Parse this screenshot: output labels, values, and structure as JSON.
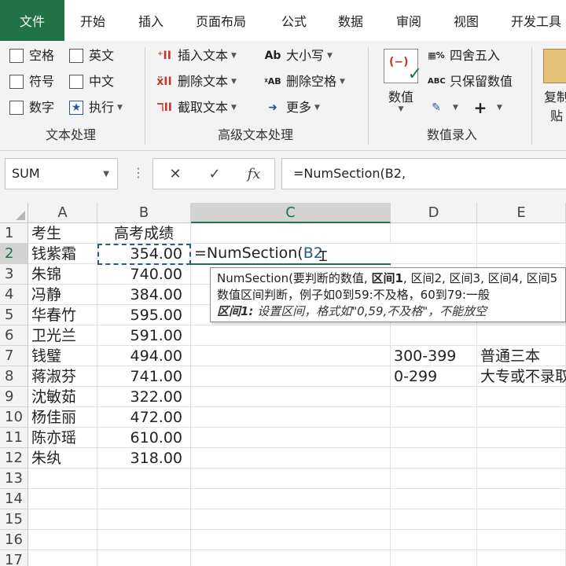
{
  "ribbon_tabs": [
    "文件",
    "开始",
    "插入",
    "页面布局",
    "公式",
    "数据",
    "审阅",
    "视图",
    "开发工具"
  ],
  "ribbon": {
    "text_group": {
      "items": [
        "空格",
        "英文",
        "符号",
        "中文",
        "数字",
        "执行"
      ],
      "label": "文本处理"
    },
    "advanced_group": {
      "items": [
        "插入文本",
        "大小写",
        "删除文本",
        "删除空格",
        "截取文本",
        "更多"
      ],
      "label": "高级文本处理"
    },
    "number_group": {
      "big_button": "数值",
      "items": [
        "四舍五入",
        "只保留数值"
      ],
      "label": "数值录入"
    },
    "clipboard": {
      "label": "复制粘贴",
      "label_parts": [
        "复制",
        "贴"
      ]
    }
  },
  "formula_bar": {
    "name_box": "SUM",
    "formula": "=NumSection(B2,"
  },
  "grid": {
    "columns": [
      "A",
      "B",
      "C",
      "D",
      "E"
    ],
    "row_numbers": [
      "1",
      "2",
      "3",
      "4",
      "5",
      "6",
      "7",
      "8",
      "9",
      "10",
      "11",
      "12",
      "13",
      "14",
      "15",
      "16",
      "17"
    ],
    "header_row": {
      "name": "考生",
      "score": "高考成绩"
    },
    "rows": [
      {
        "name": "钱紫霜",
        "score": "354.00"
      },
      {
        "name": "朱锦",
        "score": "740.00"
      },
      {
        "name": "冯静",
        "score": "384.00"
      },
      {
        "name": "华春竹",
        "score": "595.00"
      },
      {
        "name": "卫光兰",
        "score": "591.00"
      },
      {
        "name": "钱璧",
        "score": "494.00"
      },
      {
        "name": "蒋淑芬",
        "score": "741.00"
      },
      {
        "name": "沈敏茹",
        "score": "322.00"
      },
      {
        "name": "杨佳丽",
        "score": "472.00"
      },
      {
        "name": "陈亦瑶",
        "score": "610.00"
      },
      {
        "name": "朱纨",
        "score": "318.00"
      }
    ],
    "editing_cell": {
      "prefix": "=NumSection(",
      "ref": "B2",
      "suffix": ""
    },
    "ranges": [
      {
        "range": "300-399",
        "label": "普通三本"
      },
      {
        "range": "0-299",
        "label": "大专或不录取"
      }
    ]
  },
  "tooltip": {
    "line1_pre": "NumSection(要判断的数值, ",
    "line1_bold": "区间1",
    "line1_post": ", 区间2, 区间3, 区间4, 区间5",
    "line2": "数值区间判断，例子如0到59:不及格，60到79:一般",
    "line3_bold": "区间1:",
    "line3_desc": " 设置区间，格式如\"0,59,不及格\"，不能放空"
  },
  "colors": {
    "accent": "#217346",
    "ref_blue": "#2b5797"
  }
}
